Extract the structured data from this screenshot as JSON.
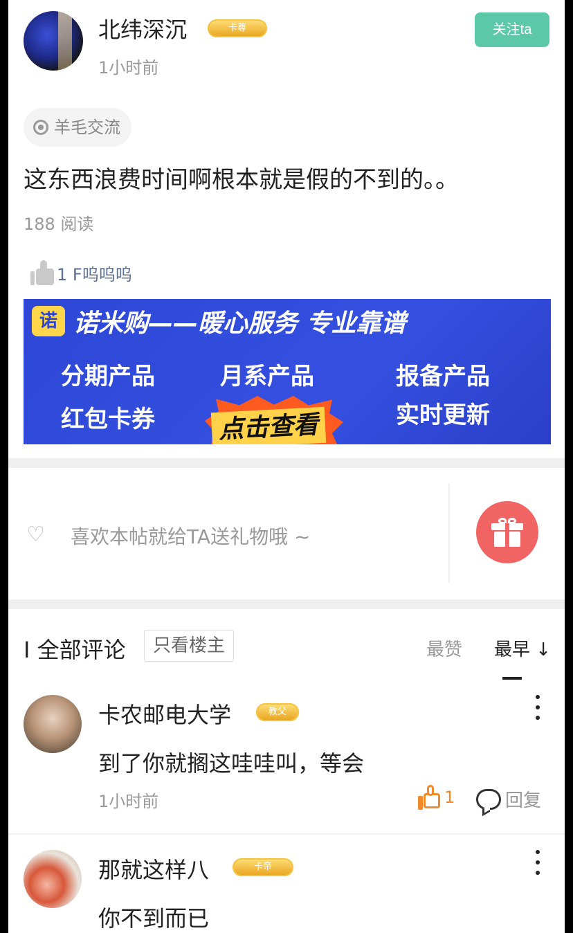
{
  "post": {
    "author": "北纬深沉",
    "badge": "卡尊",
    "time": "1小时前",
    "follow_label": "关注ta",
    "topic": "羊毛交流",
    "content": "这东西浪费时间啊根本就是假的不到的。。",
    "read_count": "188 阅读",
    "like_text": "1 F呜呜呜"
  },
  "ad": {
    "logo": "诺",
    "title": "诺米购——暖心服务 专业靠谱",
    "items": [
      "分期产品",
      "月系产品",
      "报备产品",
      "红包卡券",
      "实时更新"
    ],
    "cta": "点击查看",
    "brand_color": "#2d46d6"
  },
  "gift": {
    "caption": "喜欢本帖就给TA送礼物哦 ~",
    "accent": "#f16464"
  },
  "comments_header": {
    "title": "I 全部评论",
    "only_op": "只看楼主",
    "sort_hot": "最赞",
    "sort_early": "最早 ↓"
  },
  "comments": [
    {
      "name": "卡农邮电大学",
      "badge": "教父",
      "text": "到了你就搁这哇哇叫，等会",
      "time": "1小时前",
      "likes": "1",
      "reply_label": "回复"
    },
    {
      "name": "那就这样八",
      "badge": "卡帝",
      "text": "你不到而已"
    }
  ],
  "colors": {
    "follow_button": "#5bc9a8",
    "like_accent": "#f08a2a"
  }
}
